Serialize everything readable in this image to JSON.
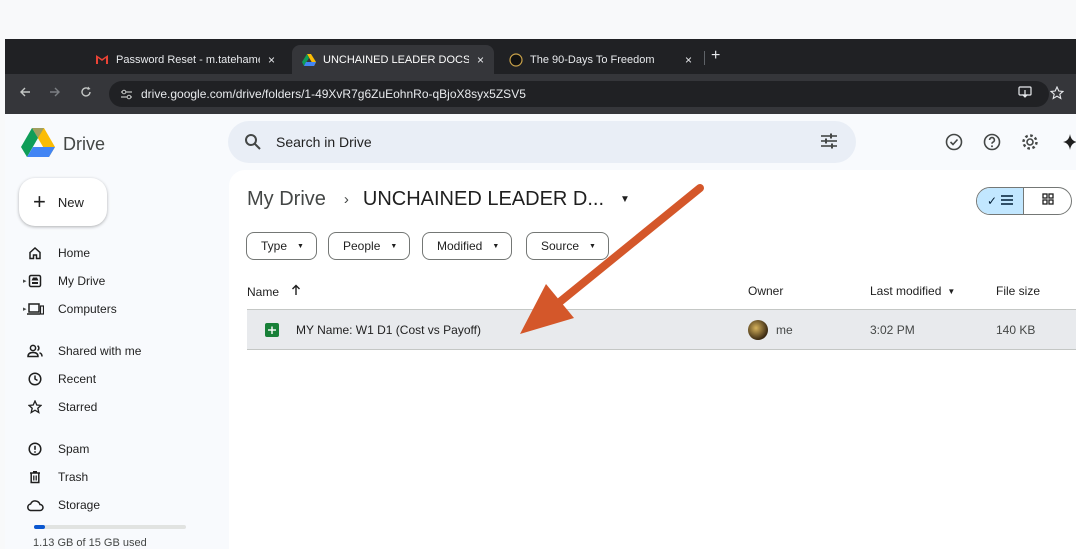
{
  "browser": {
    "tabs": [
      {
        "title": "Password Reset - m.tatehame",
        "close": "×"
      },
      {
        "title": "UNCHAINED LEADER DOCS -",
        "close": "×"
      },
      {
        "title": "The 90-Days To Freedom",
        "close": "×"
      }
    ],
    "new_tab": "+",
    "url": "drive.google.com/drive/folders/1-49XvR7g6ZuEohnRo-qBjoX8syx5ZSV5"
  },
  "app": {
    "name": "Drive",
    "search_placeholder": "Search in Drive"
  },
  "sidebar": {
    "new_label": "New",
    "items": [
      {
        "label": "Home",
        "icon": "home-icon"
      },
      {
        "label": "My Drive",
        "icon": "my-drive-icon"
      },
      {
        "label": "Computers",
        "icon": "computers-icon"
      },
      {
        "label": "Shared with me",
        "icon": "shared-icon"
      },
      {
        "label": "Recent",
        "icon": "clock-icon"
      },
      {
        "label": "Starred",
        "icon": "star-icon"
      },
      {
        "label": "Spam",
        "icon": "spam-icon"
      },
      {
        "label": "Trash",
        "icon": "trash-icon"
      },
      {
        "label": "Storage",
        "icon": "cloud-icon"
      }
    ],
    "storage_text": "1.13 GB of 15 GB used",
    "storage_fraction": 0.075
  },
  "main": {
    "breadcrumb_root": "My Drive",
    "breadcrumb_sep": "›",
    "breadcrumb_current": "UNCHAINED LEADER D...",
    "filters": [
      "Type",
      "People",
      "Modified",
      "Source"
    ],
    "columns": {
      "name": "Name",
      "owner": "Owner",
      "modified": "Last modified",
      "size": "File size"
    },
    "files": [
      {
        "name": "MY Name: W1 D1 (Cost vs Payoff)",
        "owner": "me",
        "modified": "3:02 PM",
        "size": "140 KB"
      }
    ]
  },
  "colors": {
    "annotation_arrow": "#d4572a",
    "accent": "#0b57d0"
  }
}
